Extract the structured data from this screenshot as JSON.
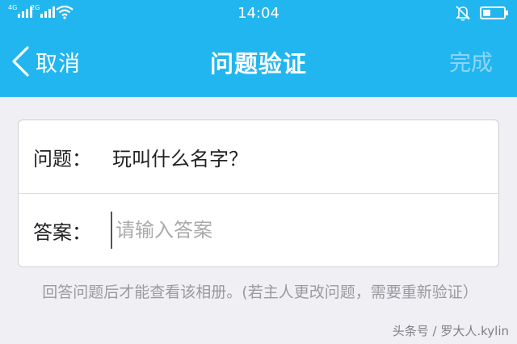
{
  "status_bar": {
    "sim1_label": "4G",
    "sim2_label": "2G",
    "time": "14:04",
    "icons": [
      "signal-icon",
      "signal-icon",
      "wifi-icon",
      "bell-muted-icon",
      "battery-icon"
    ]
  },
  "nav": {
    "back_label": "取消",
    "title": "问题验证",
    "done_label": "完成"
  },
  "form": {
    "question_label": "问题：",
    "question_text": "玩叫什么名字？",
    "answer_label": "答案：",
    "answer_value": "",
    "answer_placeholder": "请输入答案"
  },
  "hint": "回答问题后才能查看该相册。(若主人更改问题，需要重新验证）",
  "watermark": "头条号 / 罗大人.kylin",
  "colors": {
    "header_bg": "#22b6f0",
    "page_bg": "#efeff4",
    "done_disabled": "#8fd6f5"
  }
}
